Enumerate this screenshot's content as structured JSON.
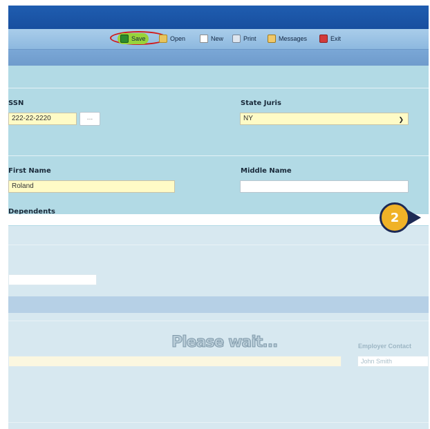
{
  "toolbar": {
    "save": "Save",
    "open": "Open",
    "new": "New",
    "print": "Print",
    "messages": "Messages",
    "exit": "Exit"
  },
  "form": {
    "ssn_label": "SSN",
    "ssn_value": "222-22-2220",
    "ssn_lookup": "...",
    "state_juris_label": "State Juris",
    "state_juris_value": "NY",
    "first_name_label": "First Name",
    "first_name_value": "Roland",
    "middle_name_label": "Middle Name",
    "middle_name_value": "",
    "dependents_label": "Dependents"
  },
  "overlay": {
    "please_wait": "Please wait...",
    "employer_contact_label": "Employer Contact",
    "employer_contact_value": "John Smith"
  },
  "callout": {
    "number": "2"
  },
  "colors": {
    "titlebar": "#1f5db0",
    "toolbar": "#9fc5e8",
    "form_bg": "#b2dae5",
    "field_yellow": "#fffbc6",
    "callout_fill": "#f0b227",
    "callout_border": "#1d2a55",
    "highlight_ring": "#d01c1c"
  }
}
